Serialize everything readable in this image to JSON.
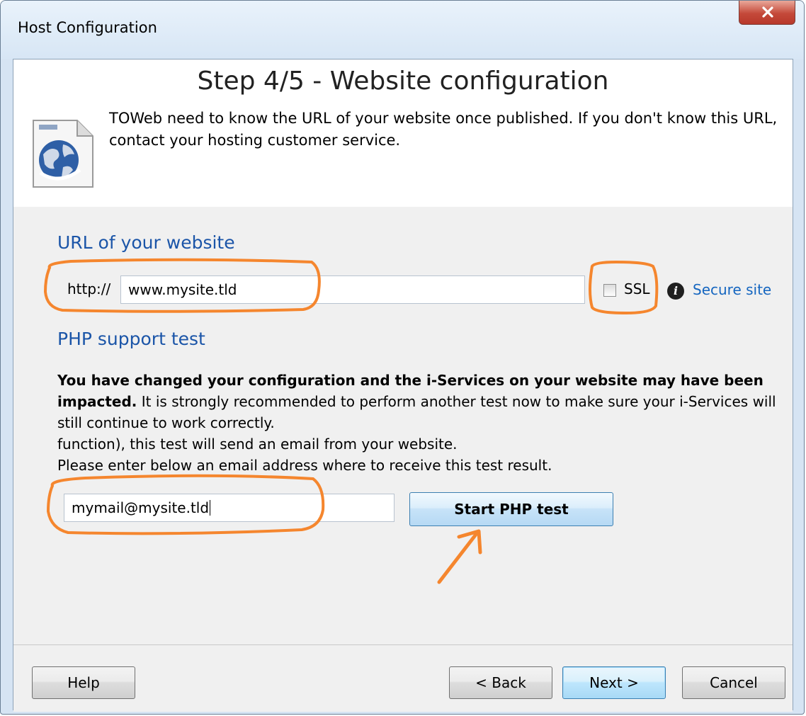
{
  "window": {
    "title": "Host Configuration"
  },
  "header": {
    "step_title": "Step 4/5 - Website configuration",
    "description": "TOWeb need to know the URL of your website once published. If you don't know this URL, contact your hosting customer service."
  },
  "url_section": {
    "title": "URL of your website",
    "prefix": "http://",
    "url_value": "www.mysite.tld",
    "ssl_label": "SSL",
    "ssl_checked": false,
    "secure_site_link": "Secure site"
  },
  "php_section": {
    "title": "PHP support test",
    "bold_text": "You have changed your configuration and the i-Services on your website may have been impacted.",
    "text_1": " It is strongly recommended to perform another test now to make sure your i-Services will still continue to work correctly.",
    "text_2": "function), this test will send an email from your website.",
    "text_3": "Please enter below an email address where to receive this test result.",
    "email_value": "mymail@mysite.tld",
    "start_button": "Start PHP test"
  },
  "footer": {
    "help": "Help",
    "back": "< Back",
    "next": "Next >",
    "cancel": "Cancel"
  },
  "colors": {
    "annotation": "#f5862e",
    "section_title": "#1b55a8",
    "link": "#1566c0"
  }
}
